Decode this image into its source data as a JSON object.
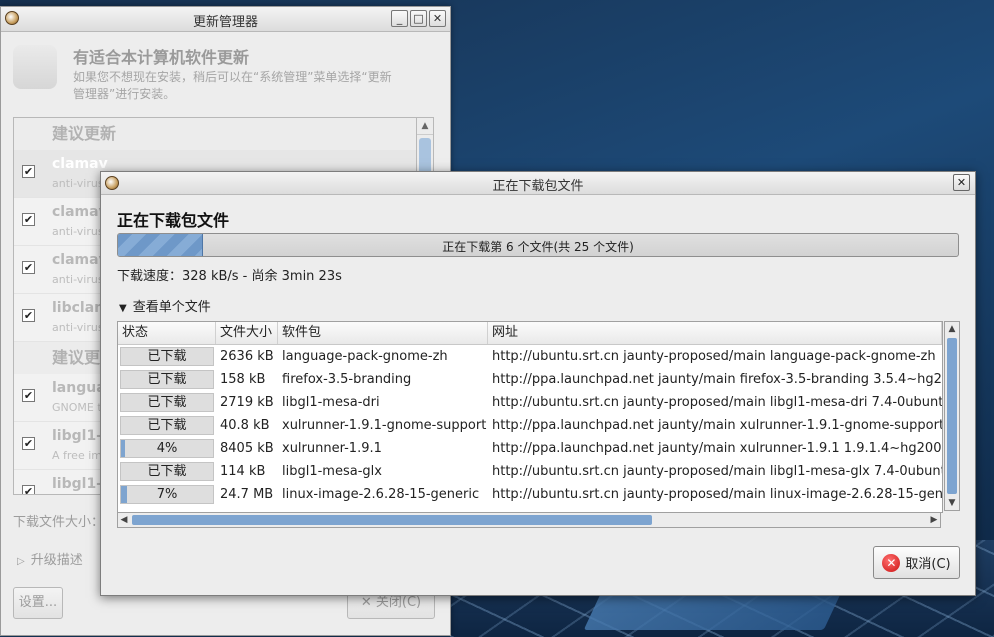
{
  "update_manager": {
    "title": "更新管理器",
    "heading": "有适合本计算机软件更新",
    "description": "如果您不想现在安装，稍后可以在“系统管理”菜单选择“更新管理器”进行安装。",
    "category_recommended": "建议更新",
    "category_recommended_2": "建议更",
    "packages": [
      {
        "name": "clamav",
        "sub": "anti-virus",
        "checked": true,
        "selected": true
      },
      {
        "name": "clamav",
        "sub": "anti-virus",
        "checked": true
      },
      {
        "name": "clamav",
        "sub": "anti-virus",
        "checked": true
      },
      {
        "name": "libclam",
        "sub": "anti-virus",
        "checked": true
      }
    ],
    "packages_2": [
      {
        "name": "langua",
        "sub": "GNOME t",
        "checked": true
      },
      {
        "name": "libgl1-",
        "sub": "A free im",
        "checked": true
      },
      {
        "name": "libgl1-",
        "sub": "",
        "checked": true
      }
    ],
    "download_size_label": "下载文件大小：",
    "upgrade_desc_label": "升级描述",
    "settings_button": "设置...",
    "close_button": "关闭(C)"
  },
  "dialog": {
    "title": "正在下载包文件",
    "heading": "正在下载包文件",
    "progress_text": "正在下载第 6 个文件(共 25 个文件)",
    "progress_fraction": 0.1,
    "speed_text": "下载速度：328 kB/s - 尚余 3min 23s",
    "expander_label": "查看单个文件",
    "columns": {
      "status": "状态",
      "size": "文件大小",
      "package": "软件包",
      "url": "网址"
    },
    "rows": [
      {
        "status": "已下载",
        "progress": 1.0,
        "size": "2636 kB",
        "package": "language-pack-gnome-zh",
        "url": "http://ubuntu.srt.cn jaunty-proposed/main language-pack-gnome-zh"
      },
      {
        "status": "已下载",
        "progress": 1.0,
        "size": "158 kB",
        "package": "firefox-3.5-branding",
        "url": "http://ppa.launchpad.net jaunty/main firefox-3.5-branding 3.5.4~hg2"
      },
      {
        "status": "已下载",
        "progress": 1.0,
        "size": "2719 kB",
        "package": "libgl1-mesa-dri",
        "url": "http://ubuntu.srt.cn jaunty-proposed/main libgl1-mesa-dri 7.4-0ubunt"
      },
      {
        "status": "已下载",
        "progress": 1.0,
        "size": "40.8 kB",
        "package": "xulrunner-1.9.1-gnome-support",
        "url": "http://ppa.launchpad.net jaunty/main xulrunner-1.9.1-gnome-support"
      },
      {
        "status": "4%",
        "progress": 0.04,
        "size": "8405 kB",
        "package": "xulrunner-1.9.1",
        "url": "http://ppa.launchpad.net jaunty/main xulrunner-1.9.1 1.9.1.4~hg2009"
      },
      {
        "status": "已下载",
        "progress": 1.0,
        "size": "114 kB",
        "package": "libgl1-mesa-glx",
        "url": "http://ubuntu.srt.cn jaunty-proposed/main libgl1-mesa-glx 7.4-0ubunt"
      },
      {
        "status": "7%",
        "progress": 0.07,
        "size": "24.7 MB",
        "package": "linux-image-2.6.28-15-generic",
        "url": "http://ubuntu.srt.cn jaunty-proposed/main linux-image-2.6.28-15-gen"
      }
    ],
    "cancel_button": "取消(C)"
  },
  "colors": {
    "progress_fill": "#7ea4cf",
    "accent": "#6e98c8",
    "cancel_icon": "#cc1010"
  },
  "icons": {
    "window_close": "close-icon",
    "cancel": "cancel-x-icon",
    "expander": "triangle-down-icon",
    "upgrade_expander": "triangle-right-icon"
  }
}
